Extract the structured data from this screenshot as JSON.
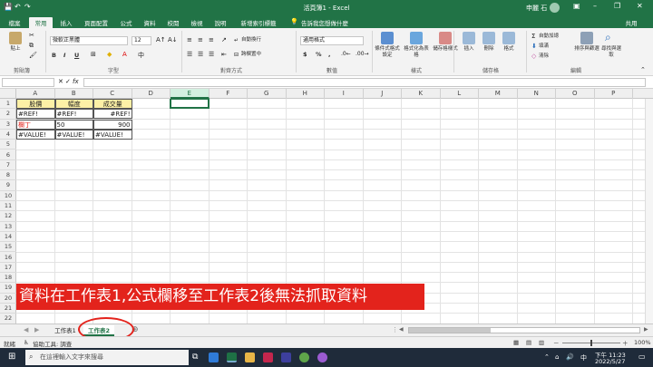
{
  "window": {
    "title": "活頁簿1 - Excel",
    "user": "申麗 石",
    "minimize": "–",
    "restore": "❐",
    "close": "✕"
  },
  "ribbon_tabs": [
    "檔案",
    "常用",
    "插入",
    "頁面配置",
    "公式",
    "資料",
    "校閱",
    "檢視",
    "說明",
    "新增索引標籤"
  ],
  "active_tab": "常用",
  "tell_me": "告訴我您想做什麼",
  "share_label": "共用",
  "groups": {
    "clipboard": {
      "label": "剪貼簿",
      "paste": "貼上"
    },
    "font": {
      "label": "字型",
      "font_name": "微軟正黑體",
      "font_size": "12",
      "bold": "B",
      "italic": "I",
      "underline": "U"
    },
    "alignment": {
      "label": "對齊方式",
      "wrap": "自動換行",
      "merge": "跨欄置中"
    },
    "number": {
      "label": "數值",
      "format": "通用格式",
      "currency": "$",
      "percent": "%",
      "comma": ","
    },
    "styles": {
      "label": "樣式",
      "conditional": "條件式格式設定",
      "table": "格式化為表格",
      "cell": "儲存格樣式"
    },
    "cells": {
      "label": "儲存格",
      "insert": "插入",
      "delete": "刪除",
      "format": "格式"
    },
    "editing": {
      "label": "編輯",
      "autosum": "自動加總",
      "fill": "填滿",
      "clear": "清除",
      "sort": "排序與篩選",
      "find": "尋找與選取"
    }
  },
  "formula_bar": {
    "name_box": "",
    "fx": "fx",
    "value": ""
  },
  "columns": [
    "A",
    "B",
    "C",
    "D",
    "E",
    "F",
    "G",
    "H",
    "I",
    "J",
    "K",
    "L",
    "M",
    "N",
    "O",
    "P"
  ],
  "selected_column": "E",
  "rows": [
    "1",
    "2",
    "3",
    "4",
    "5",
    "6",
    "7",
    "8",
    "9",
    "10",
    "11",
    "12",
    "13",
    "14",
    "15",
    "16",
    "17",
    "18",
    "19",
    "20",
    "21",
    "22"
  ],
  "cells": [
    {
      "ref": "A1",
      "text": "股價",
      "kind": "header"
    },
    {
      "ref": "B1",
      "text": "幅度",
      "kind": "header"
    },
    {
      "ref": "C1",
      "text": "成交量",
      "kind": "header"
    },
    {
      "ref": "A2",
      "text": "#REF!",
      "kind": "left"
    },
    {
      "ref": "B2",
      "text": "#REF!",
      "kind": "left"
    },
    {
      "ref": "C2",
      "text": "#REF!",
      "kind": "right"
    },
    {
      "ref": "A3",
      "text": "欄丁",
      "kind": "red"
    },
    {
      "ref": "B3",
      "text": "50",
      "kind": "left"
    },
    {
      "ref": "C3",
      "text": "900",
      "kind": "right"
    },
    {
      "ref": "A4",
      "text": "#VALUE!",
      "kind": "left"
    },
    {
      "ref": "B4",
      "text": "#VALUE!",
      "kind": "left"
    },
    {
      "ref": "C4",
      "text": "#VALUE!",
      "kind": "left"
    }
  ],
  "annotation": "資料在工作表1,公式欄移至工作表2後無法抓取資料",
  "sheets": [
    "工作表1",
    "工作表2"
  ],
  "active_sheet": "工作表2",
  "add_sheet": "⊕",
  "status": {
    "ready": "就緒",
    "accessibility": "協助工具: 調查",
    "zoom": "100%",
    "zoom_minus": "－",
    "zoom_plus": "＋"
  },
  "taskbar": {
    "search_placeholder": "在這裡輸入文字來搜尋",
    "time": "下午 11:23",
    "date": "2022/5/27",
    "ime": "中"
  },
  "colors": {
    "excel_green": "#217346",
    "banner_red": "#e3231c",
    "header_fill": "#fdf0a6"
  }
}
